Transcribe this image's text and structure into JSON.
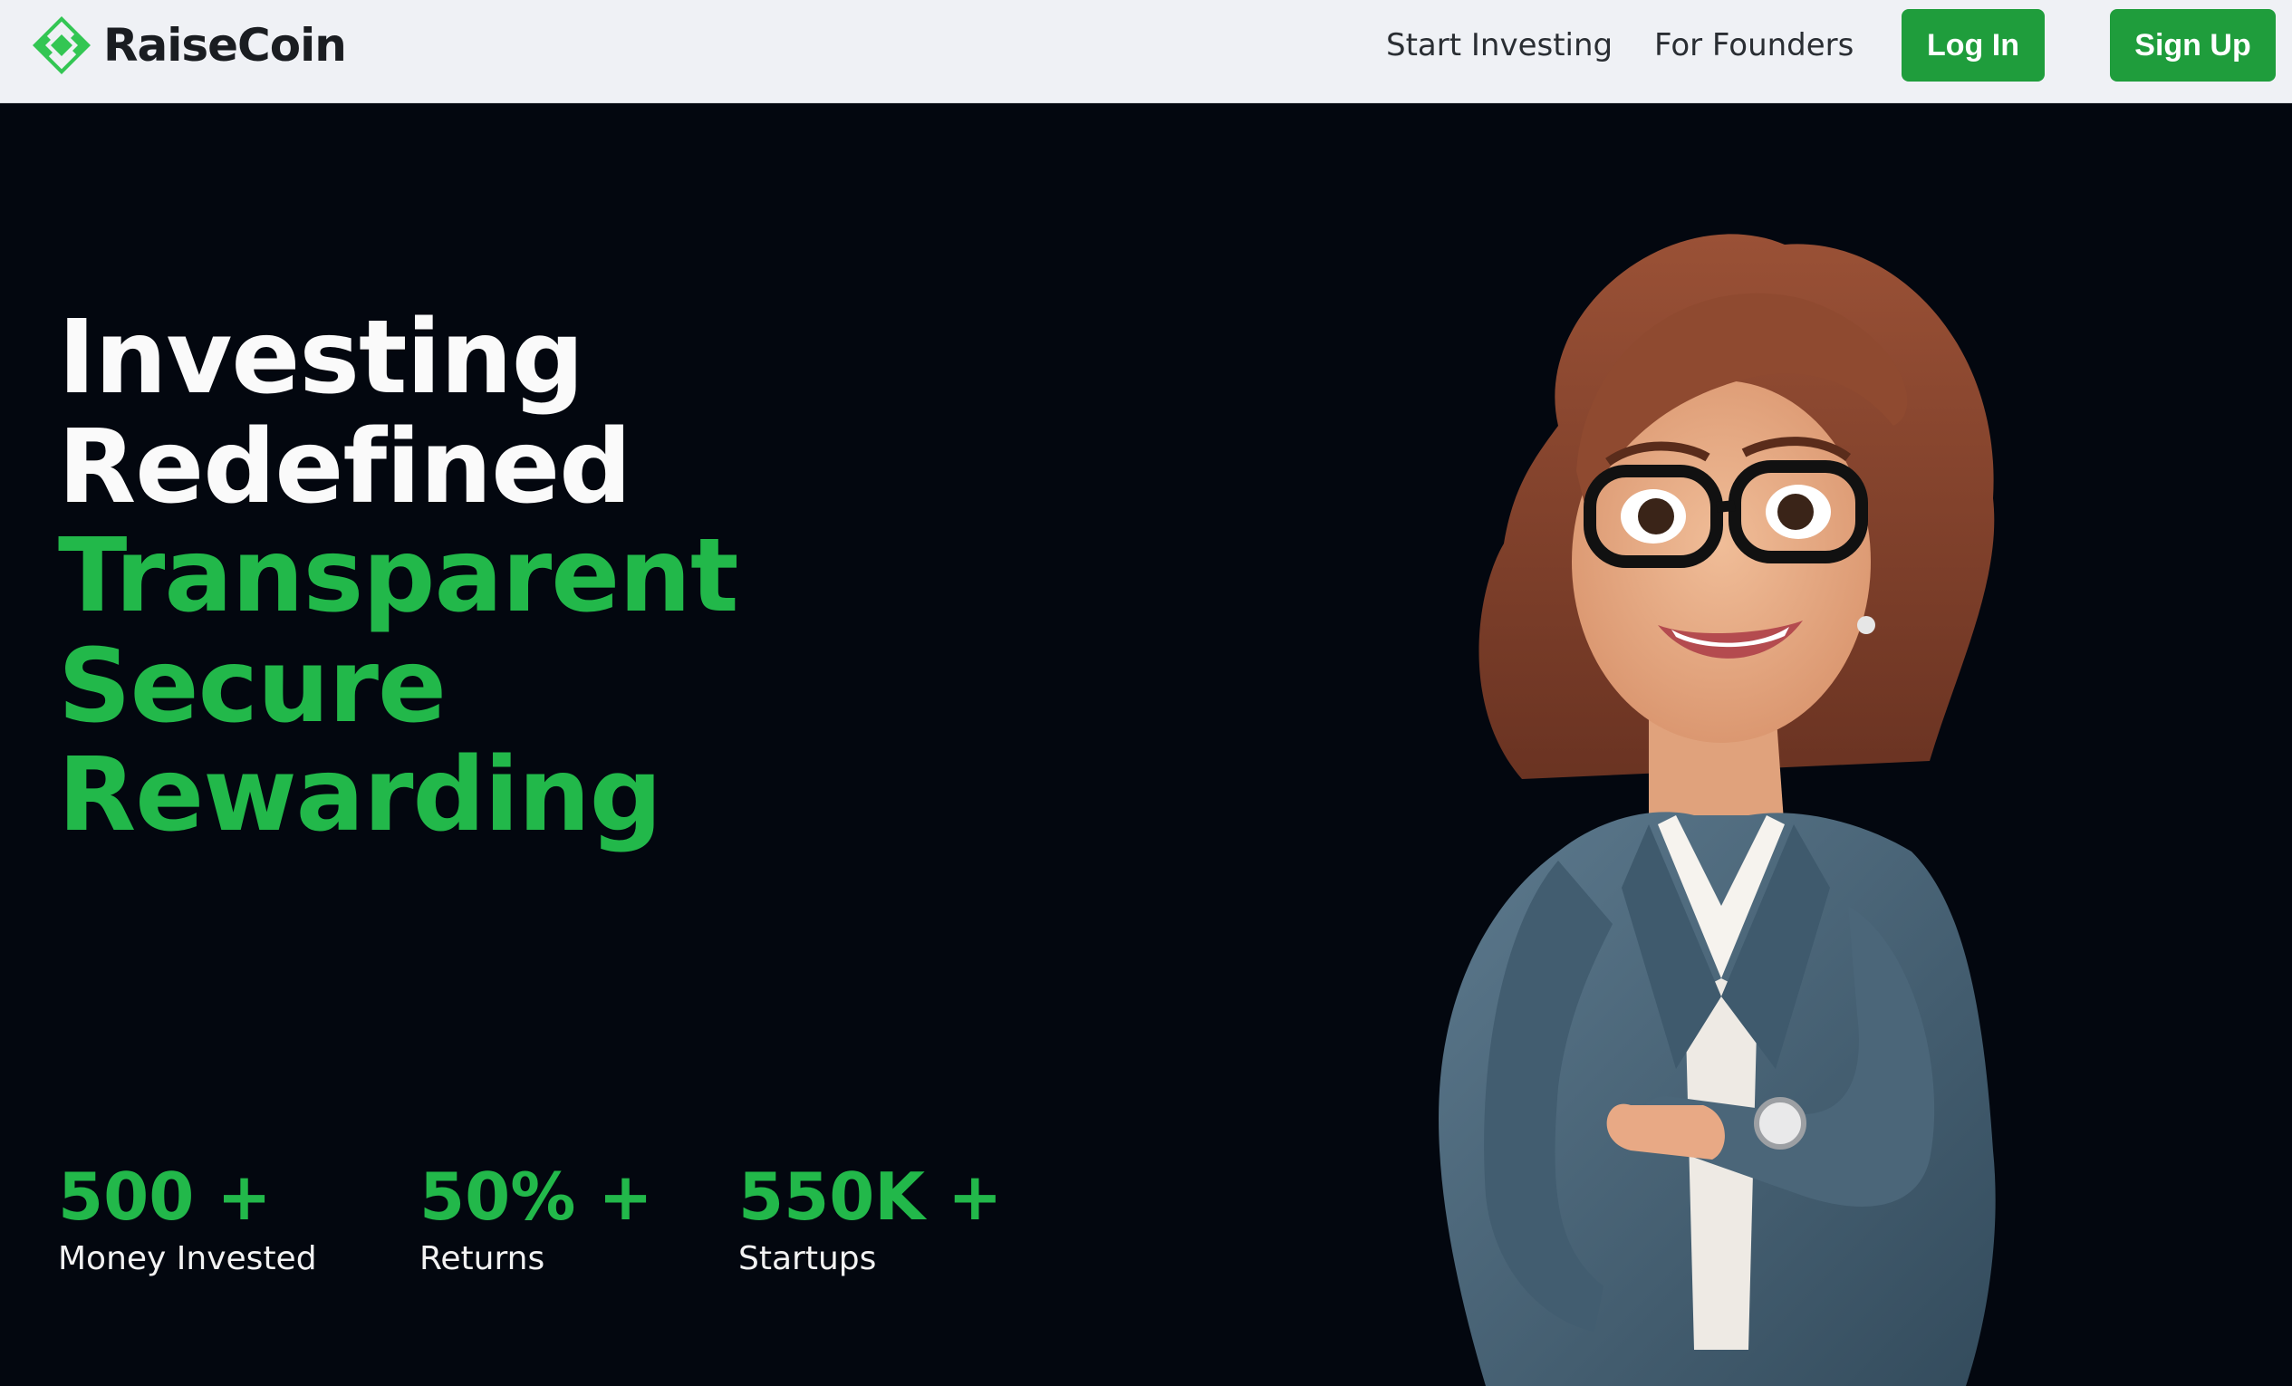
{
  "brand": {
    "name": "RaiseCoin",
    "logo_icon": "raisecoin-logo-icon",
    "color": "#33c653"
  },
  "nav": {
    "start_investing": "Start Investing",
    "for_founders": "For Founders",
    "log_in": "Log In",
    "sign_up": "Sign Up"
  },
  "hero": {
    "line1": "Investing",
    "line2": "Redefined",
    "line3": "Transparent",
    "line4": "Secure",
    "line5": "Rewarding",
    "accent_color": "#22b84a"
  },
  "stats": [
    {
      "value": "500 +",
      "label": "Money Invested"
    },
    {
      "value": "50% +",
      "label": "Returns"
    },
    {
      "value": "550K +",
      "label": "Startups"
    }
  ],
  "illustration": {
    "subject": "3d-businesswoman-illustration"
  },
  "colors": {
    "background": "#03070f",
    "navbar": "#eff1f5",
    "button": "#1f9d3c"
  }
}
